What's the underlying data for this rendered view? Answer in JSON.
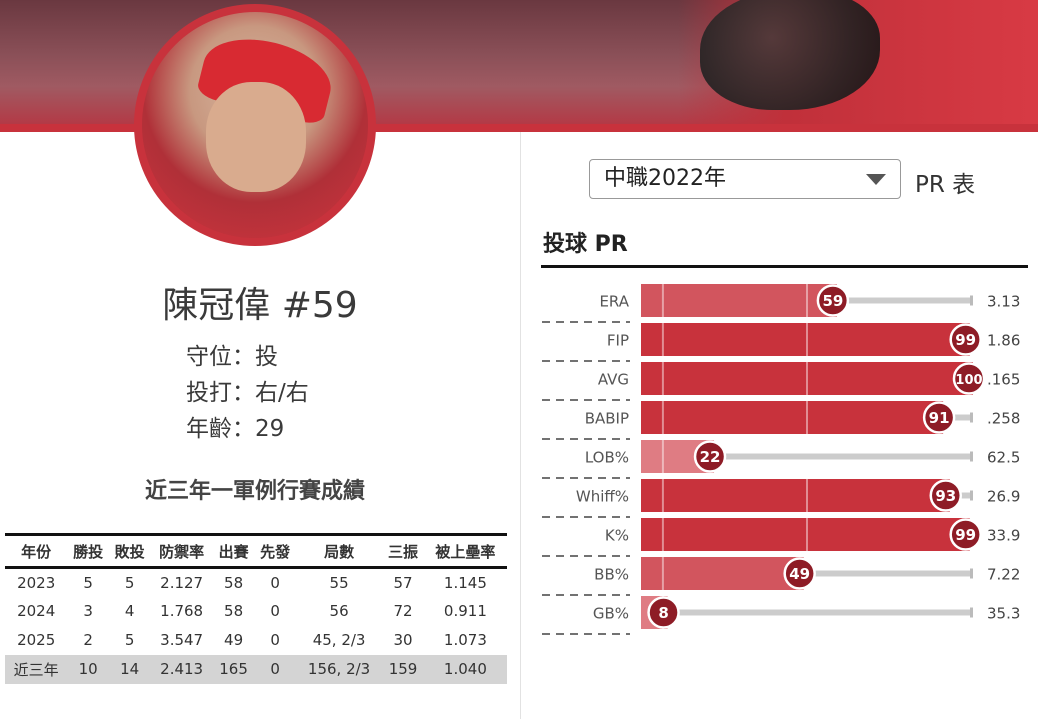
{
  "player": {
    "name": "陳冠偉 #59",
    "position": "守位：投",
    "bat_throw": "投打：右/右",
    "age": "年齡：29"
  },
  "stats_section": {
    "title": "近三年一軍例行賽成績",
    "headers": [
      "年份",
      "勝投",
      "敗投",
      "防禦率",
      "出賽",
      "先發",
      "局數",
      "三振",
      "被上壘率"
    ],
    "rows": [
      [
        "2023",
        "5",
        "5",
        "2.127",
        "58",
        "0",
        "55",
        "57",
        "1.145"
      ],
      [
        "2024",
        "3",
        "4",
        "1.768",
        "58",
        "0",
        "56",
        "72",
        "0.911"
      ],
      [
        "2025",
        "2",
        "5",
        "3.547",
        "49",
        "0",
        "45, 2/3",
        "30",
        "1.073"
      ]
    ],
    "total": [
      "近三年",
      "10",
      "14",
      "2.413",
      "165",
      "0",
      "156, 2/3",
      "159",
      "1.040"
    ]
  },
  "pr_panel": {
    "selected_season": "中職2022年",
    "pr_table_label": "PR 表",
    "title": "投球 PR"
  },
  "colors": {
    "accent": "#c8323c",
    "bar_high": "#c8323c",
    "bar_mid": "#d2555e",
    "bar_low": "#df7c83",
    "badge": "#8e1c26",
    "track": "#cccccc"
  },
  "chart_data": {
    "type": "bar",
    "orientation": "horizontal",
    "title": "投球 PR",
    "xlim": [
      0,
      100
    ],
    "categories": [
      "ERA",
      "FIP",
      "AVG",
      "BABIP",
      "LOB%",
      "Whiff%",
      "K%",
      "BB%",
      "GB%"
    ],
    "values": [
      59,
      99,
      100,
      91,
      22,
      93,
      99,
      49,
      8
    ],
    "raw_values": [
      "3.13",
      "1.86",
      ".165",
      ".258",
      "62.5",
      "26.9",
      "33.9",
      "7.22",
      "35.3"
    ]
  }
}
